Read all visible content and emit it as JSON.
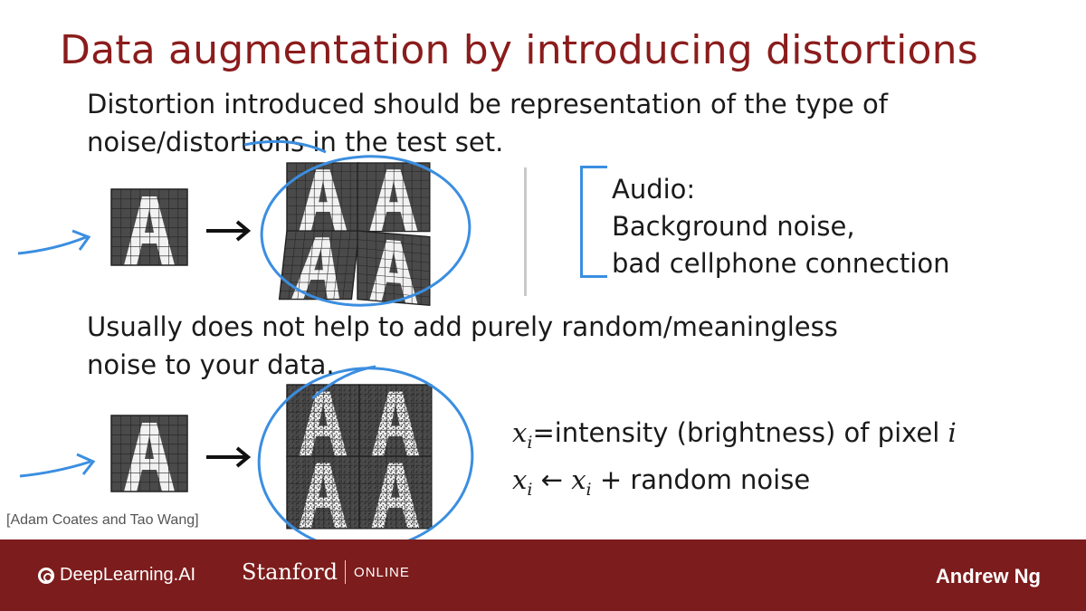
{
  "slide": {
    "title": "Data augmentation by introducing distortions",
    "para1": {
      "line1": "Distortion introduced should be representation of the type of",
      "line2": "noise/distortions in the test set."
    },
    "audio": {
      "heading": "Audio:",
      "line1": "Background noise,",
      "line2": "bad cellphone connection"
    },
    "para2": {
      "line1": "Usually does not help to add purely random/meaningless",
      "line2": "noise to your data."
    },
    "formula1": {
      "var": "x",
      "sub": "i",
      "text": "=intensity (brightness) of pixel ",
      "tail": "i"
    },
    "formula2": {
      "var": "x",
      "sub": "i",
      "arrow": " ← ",
      "var2": "x",
      "sub2": "i",
      "text": " + random noise"
    },
    "citation": "[Adam Coates and Tao Wang]"
  },
  "footer": {
    "brand1": "DeepLearning.AI",
    "brand2_main": "Stanford",
    "brand2_sub": "ONLINE",
    "presenter": "Andrew Ng"
  },
  "colors": {
    "title": "#8b1c1c",
    "footer_bg": "#7d1c1c",
    "annotation": "#3b8ee0"
  }
}
